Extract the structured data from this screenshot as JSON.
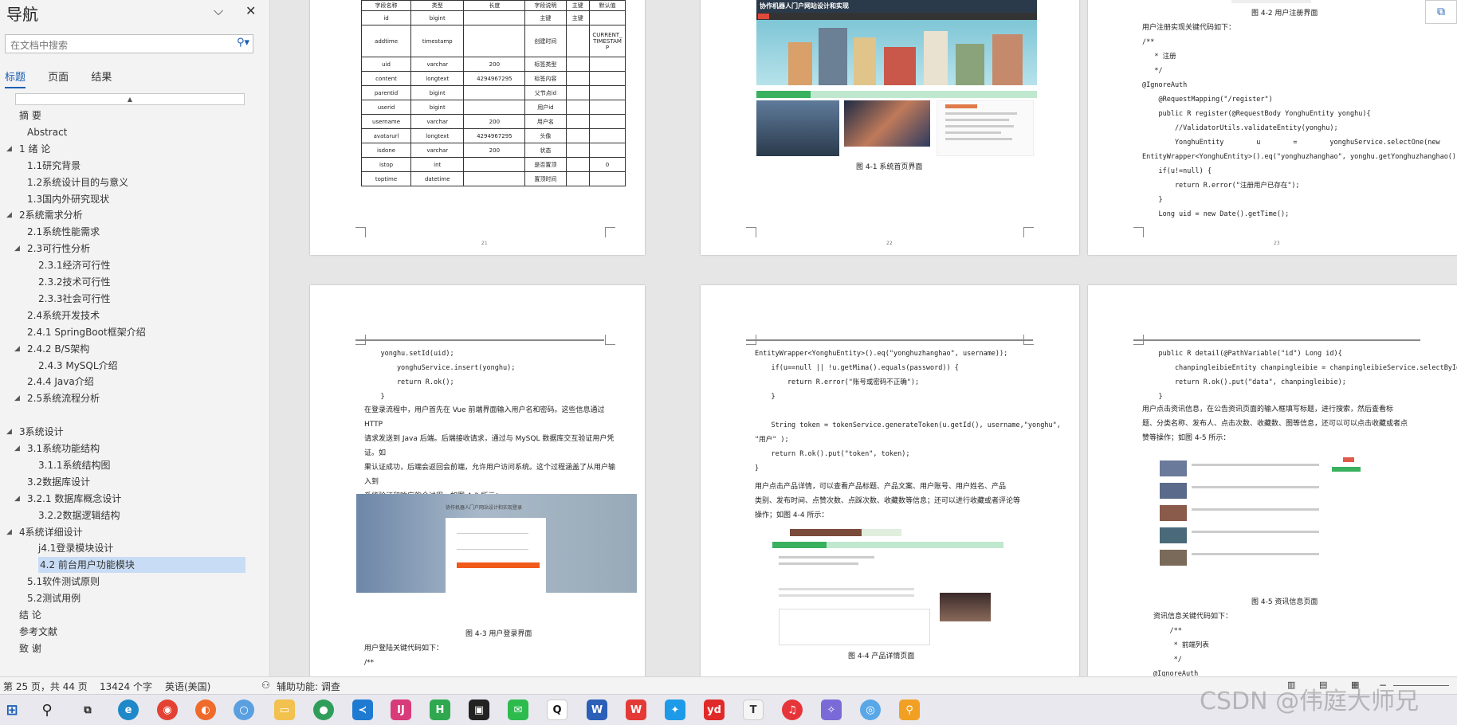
{
  "nav": {
    "title": "导航",
    "search_placeholder": "在文档中搜索",
    "tabs": [
      "标题",
      "页面",
      "结果"
    ],
    "outline": [
      {
        "label": "摘  要",
        "level": 0,
        "arrow": false
      },
      {
        "label": "Abstract",
        "level": 1,
        "arrow": false
      },
      {
        "label": "1 绪  论",
        "level": 0,
        "arrow": true
      },
      {
        "label": "1.1研究背景",
        "level": 1,
        "arrow": false
      },
      {
        "label": "1.2系统设计目的与意义",
        "level": 1,
        "arrow": false
      },
      {
        "label": "1.3国内外研究现状",
        "level": 1,
        "arrow": false
      },
      {
        "label": "2系统需求分析",
        "level": 0,
        "arrow": true
      },
      {
        "label": "2.1系统性能需求",
        "level": 1,
        "arrow": false
      },
      {
        "label": "2.3可行性分析",
        "level": 1,
        "arrow": true
      },
      {
        "label": "2.3.1经济可行性",
        "level": 2,
        "arrow": false
      },
      {
        "label": "2.3.2技术可行性",
        "level": 2,
        "arrow": false
      },
      {
        "label": "2.3.3社会可行性",
        "level": 2,
        "arrow": false
      },
      {
        "label": "2.4系统开发技术",
        "level": 1,
        "arrow": false
      },
      {
        "label": "2.4.1 SpringBoot框架介绍",
        "level": 1,
        "arrow": false
      },
      {
        "label": "2.4.2 B/S架构",
        "level": 1,
        "arrow": true
      },
      {
        "label": "2.4.3 MySQL介绍",
        "level": 2,
        "arrow": false
      },
      {
        "label": "2.4.4 Java介绍",
        "level": 1,
        "arrow": false
      },
      {
        "label": "2.5系统流程分析",
        "level": 1,
        "arrow": true
      },
      {
        "label": "",
        "level": 0,
        "arrow": false
      },
      {
        "label": "3系统设计",
        "level": 0,
        "arrow": true
      },
      {
        "label": "3.1系统功能结构",
        "level": 1,
        "arrow": true
      },
      {
        "label": "3.1.1系统结构图",
        "level": 2,
        "arrow": false
      },
      {
        "label": "3.2数据库设计",
        "level": 1,
        "arrow": false
      },
      {
        "label": "3.2.1 数据库概念设计",
        "level": 1,
        "arrow": true
      },
      {
        "label": "3.2.2数据逻辑结构",
        "level": 2,
        "arrow": false
      },
      {
        "label": "4系统详细设计",
        "level": 0,
        "arrow": true
      },
      {
        "label": "j4.1登录模块设计",
        "level": 2,
        "arrow": false
      },
      {
        "label": "4.2 前台用户功能模块",
        "level": 2,
        "arrow": false,
        "selected": true
      },
      {
        "label": "5.1软件测试原则",
        "level": 1,
        "arrow": false
      },
      {
        "label": "5.2测试用例",
        "level": 1,
        "arrow": false
      },
      {
        "label": "结  论",
        "level": 0,
        "arrow": false
      },
      {
        "label": "参考文献",
        "level": 0,
        "arrow": false
      },
      {
        "label": "致  谢",
        "level": 0,
        "arrow": false
      }
    ]
  },
  "pages": {
    "p21": {
      "number": "21",
      "table_headers": [
        "字段名称",
        "类型",
        "长度",
        "字段说明",
        "主键",
        "默认值"
      ],
      "table_rows": [
        [
          "id",
          "bigint",
          "",
          "主键",
          "主键",
          ""
        ],
        [
          "addtime",
          "timestamp",
          "",
          "创建时间",
          "",
          "CURRENT_TIMESTAMP"
        ],
        [
          "uid",
          "varchar",
          "200",
          "标签类型",
          "",
          ""
        ],
        [
          "content",
          "longtext",
          "4294967295",
          "标签内容",
          "",
          ""
        ],
        [
          "parentid",
          "bigint",
          "",
          "父节点id",
          "",
          ""
        ],
        [
          "userid",
          "bigint",
          "",
          "用户id",
          "",
          ""
        ],
        [
          "username",
          "varchar",
          "200",
          "用户名",
          "",
          ""
        ],
        [
          "avatarurl",
          "longtext",
          "4294967295",
          "头像",
          "",
          ""
        ],
        [
          "isdone",
          "varchar",
          "200",
          "状态",
          "",
          ""
        ],
        [
          "istop",
          "int",
          "",
          "是否置顶",
          "",
          "0"
        ],
        [
          "toptime",
          "datetime",
          "",
          "置顶时间",
          "",
          ""
        ]
      ]
    },
    "p22": {
      "number": "22",
      "site_title": "协作机器人门户网站设计和实现",
      "caption": "图 4-1 系统首页界面"
    },
    "p23": {
      "number": "23",
      "top_caption": "图 4-2 用户注册界面",
      "intro": "用户注册实现关键代码如下：",
      "code": [
        "/**",
        "   * 注册",
        "   */",
        "@IgnoreAuth",
        "    @RequestMapping(\"/register\")",
        "    public R register(@RequestBody YonghuEntity yonghu){",
        "        //ValidatorUtils.validateEntity(yonghu);",
        "        YonghuEntity        u        =        yonghuService.selectOne(new",
        "EntityWrapper<YonghuEntity>().eq(\"yonghuzhanghao\", yonghu.getYonghuzhanghao()));",
        "    if(u!=null) {",
        "        return R.error(\"注册用户已存在\");",
        "    }",
        "    Long uid = new Date().getTime();"
      ]
    },
    "p24": {
      "code": [
        "    yonghu.setId(uid);",
        "        yonghuService.insert(yonghu);",
        "        return R.ok();",
        "    }"
      ],
      "para": [
        "    在登录流程中，用户首先在 Vue 前端界面输入用户名和密码。这些信息通过 HTTP",
        "请求发送到 Java 后端。后端接收请求，通过与 MySQL 数据库交互验证用户凭证。如",
        "果认证成功，后端会返回会前端，允许用户访问系统。这个过程涵盖了从用户输入到",
        "系统验证和响应的全过程。如图 4-3 所示："
      ],
      "login_title": "协作机器人门户网站设计和实现登录",
      "caption": "图 4-3 用户登录界面",
      "after": "用户登陆关键代码如下：",
      "after2": "/**"
    },
    "p25": {
      "code": [
        "EntityWrapper<YonghuEntity>().eq(\"yonghuzhanghao\", username));",
        "    if(u==null || !u.getMima().equals(password)) {",
        "        return R.error(\"账号或密码不正确\");",
        "    }",
        "",
        "    String token = tokenService.generateToken(u.getId(), username,\"yonghu\",",
        "\"用户\" );",
        "    return R.ok().put(\"token\", token);",
        "}"
      ],
      "para": [
        "    用户点击产品详情，可以查看产品标题、产品文案、用户账号、用户姓名、产品",
        "类别、发布时间、点赞次数、点踩次数、收藏数等信息；还可以进行收藏或者评论等",
        "操作；如图 4-4 所示："
      ],
      "caption": "图 4-4 产品详情页面"
    },
    "p26": {
      "code": [
        "    public R detail(@PathVariable(\"id\") Long id){",
        "        chanpingleibieEntity chanpingleibie = chanpingleibieService.selectById(id);",
        "        return R.ok().put(\"data\", chanpingleibie);",
        "    }"
      ],
      "para": [
        "    用户点击资讯信息，在公告资讯页面的输入框填写标题，进行搜索，然后查看标",
        "题、分类名称、发布人、点击次数、收藏数、图等信息，还可以可以点击收藏或者点",
        "赞等操作；如图 4-5 所示："
      ],
      "caption": "图 4-5 资讯信息页面",
      "after": "资讯信息关键代码如下：",
      "after_code": [
        "    /**",
        "     * 前端列表",
        "     */",
        "@IgnoreAuth"
      ]
    }
  },
  "status": {
    "page": "第 25 页，共 44 页",
    "words": "13424 个字",
    "lang": "英语(美国)",
    "accessibility": "辅助功能: 调查"
  },
  "taskbar": {
    "icons": [
      "windows-start-icon",
      "search-icon",
      "task-view-icon",
      "edge-icon",
      "chrome-icon",
      "firefox-icon",
      "browser-icon",
      "file-explorer-icon",
      "maps-icon",
      "vscode-icon",
      "intellij-icon",
      "hbuilder-icon",
      "app-icon",
      "wechat-icon",
      "qq-icon",
      "word-icon",
      "wps-icon",
      "feishu-icon",
      "youdao-icon",
      "typora-icon",
      "netease-music-icon",
      "app2-icon",
      "app3-icon",
      "search-tool-icon"
    ]
  },
  "watermark": "CSDN @伟庭大师兄"
}
